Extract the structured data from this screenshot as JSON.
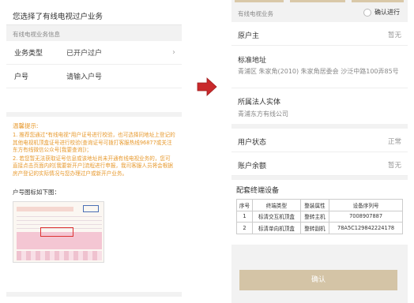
{
  "left": {
    "header_title": "您选择了有线电视过户业务",
    "section_label": "有线电视业务信息",
    "rows": [
      {
        "label": "业务类型",
        "value": "已开户过户"
      },
      {
        "label": "户号",
        "value": "请输入户号"
      }
    ],
    "tips_title": "温馨提示:",
    "tips": [
      "1. 推荐您通过\"有线电视\"用户证号进行校验，也可选择同地址上登记的其他电视机顶盒证号进行校验(查询证号可拨打客服热线96877或关注东方有线微信公众号[我要查询])；",
      "2. 若您暂无法获取证号信息或该地址尚未开通有线电视业务的，您可直接点击页面内的[我要新开户]流程进行申报，我司客服人员将会根据房产登记的实际情况与您办理过户或新开户业务。"
    ],
    "image_caption": "户号图标如下图："
  },
  "right": {
    "section_label": "有线电视业务",
    "confirm_label": "确认进行",
    "rows": {
      "holder": {
        "label": "原户主",
        "value": "暂无"
      },
      "address": {
        "label": "标准地址",
        "value": "青浦区 朱家角(2010) 朱家角居委会 沙泛中路100弄85号"
      },
      "entity": {
        "label": "所属法人实体",
        "value": "青浦东方有线公司"
      },
      "status": {
        "label": "用户状态",
        "value": "正常"
      },
      "balance": {
        "label": "账户余额",
        "value": "暂无"
      }
    },
    "devices_title": "配套终端设备",
    "devices_headers": [
      "序号",
      "终端类型",
      "整装属性",
      "设备序列号"
    ],
    "devices_rows": [
      [
        "1",
        "标清交互机顶盒",
        "整转主机",
        "7008907887"
      ],
      [
        "2",
        "标清单向机顶盒",
        "整转副机",
        "78A5C129842224178"
      ]
    ],
    "confirm_button": "确认"
  },
  "colors": {
    "tip_orange": "#e7992d",
    "button_beige": "#d4c4a6",
    "arrow_red": "#c9292b"
  }
}
